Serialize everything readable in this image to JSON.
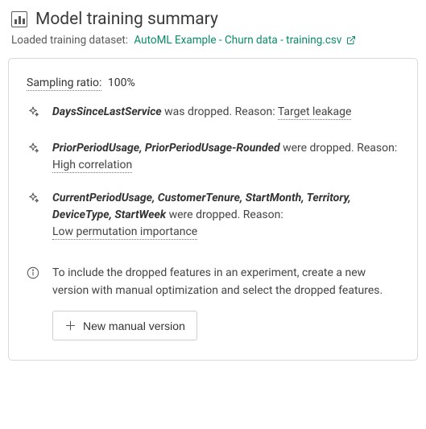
{
  "header": {
    "title": "Model training summary",
    "subhead_prefix": "Loaded training dataset:",
    "dataset_link": "AutoML Example - Churn data - training.csv"
  },
  "card": {
    "sampling_label": "Sampling ratio:",
    "sampling_value": "100%",
    "drops": [
      {
        "features": "DaysSinceLastService",
        "verb": " was dropped. Reason: ",
        "reason": "Target leakage",
        "reason_inline": true
      },
      {
        "features": "PriorPeriodUsage, PriorPeriodUsage-Rounded",
        "verb": " were dropped. Reason:",
        "reason": "High correlation",
        "reason_inline": false
      },
      {
        "features": "CurrentPeriodUsage, CustomerTenure, StartMonth, Territory, DeviceType, StartWeek",
        "verb": " were dropped. Reason:",
        "reason": "Low permutation importance",
        "reason_inline": false
      }
    ],
    "info_text": "To include the dropped features in an experiment, create a new version with manual optimization and select the dropped features.",
    "button_label": "New manual version"
  }
}
